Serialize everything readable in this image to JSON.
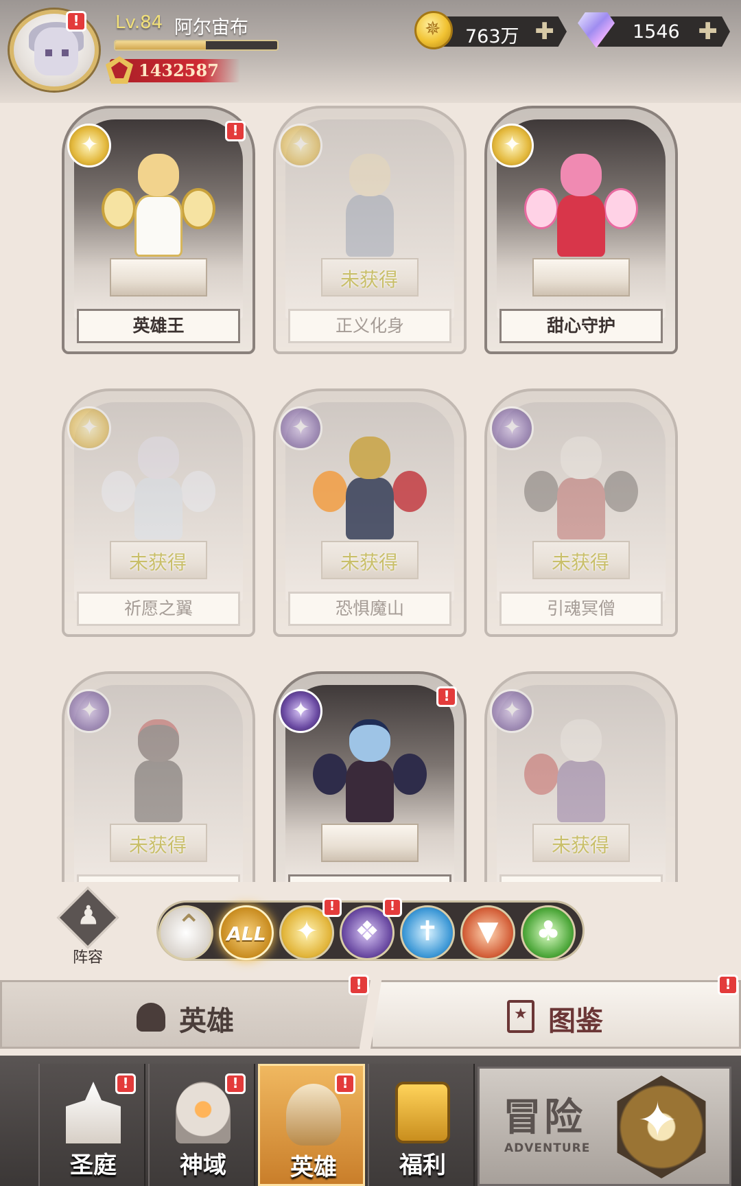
{
  "player": {
    "level": "Lv.84",
    "name": "阿尔宙布",
    "exp_fraction": 0.56,
    "power": "1432587"
  },
  "resources": {
    "gold": "763万",
    "gems": "1546",
    "plus": "✚"
  },
  "alert_mark": "!",
  "unobtained_label": "未获得",
  "heroes": [
    {
      "name": "英雄王",
      "owned": true,
      "faction": "light",
      "alert": true
    },
    {
      "name": "正义化身",
      "owned": false,
      "faction": "light",
      "alert": false
    },
    {
      "name": "甜心守护",
      "owned": true,
      "faction": "light",
      "alert": false
    },
    {
      "name": "祈愿之翼",
      "owned": false,
      "faction": "light",
      "alert": false
    },
    {
      "name": "恐惧魔山",
      "owned": false,
      "faction": "dark",
      "alert": false
    },
    {
      "name": "引魂冥僧",
      "owned": false,
      "faction": "dark",
      "alert": false
    },
    {
      "name": "",
      "owned": false,
      "faction": "dark",
      "alert": false
    },
    {
      "name": "",
      "owned": true,
      "faction": "dark",
      "alert": true
    },
    {
      "name": "",
      "owned": false,
      "faction": "dark",
      "alert": false
    }
  ],
  "lineup_label": "阵容",
  "filters": {
    "all_label": "ALL",
    "items": [
      "collapse",
      "all",
      "light",
      "dark",
      "holy",
      "beast",
      "nature"
    ]
  },
  "tabs": {
    "heroes": "英雄",
    "codex": "图鉴"
  },
  "nav": {
    "court": "圣庭",
    "realm": "神域",
    "heroes": "英雄",
    "welfare": "福利",
    "adventure": "冒险",
    "adventure_sub": "ADVENTURE"
  },
  "colors": {
    "accent_gold": "#e3b83c",
    "alert_red": "#e33b3b",
    "dark_faction": "#6a4aa2"
  }
}
